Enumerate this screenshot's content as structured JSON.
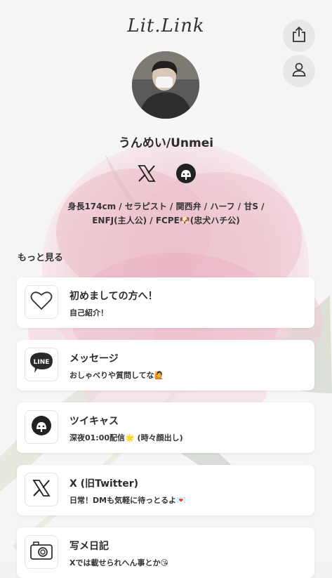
{
  "logo": "Lit.Link",
  "profile": {
    "name": "うんめい/Unmei",
    "bio_line1": "身長174cm / セラピスト / 関西弁 / ハーフ / 甘S /",
    "bio_line2": "ENFJ(主人公) / FCPE🐶(忠犬ハチ公)"
  },
  "social_icons": [
    "x-icon",
    "twitcasting-icon"
  ],
  "more_label": "もっと見る",
  "links": [
    {
      "icon": "heart-icon",
      "title": "初めましての方へ！",
      "sub": "自己紹介！"
    },
    {
      "icon": "line-icon",
      "title": "メッセージ",
      "sub": "おしゃべりや質問してな🙋"
    },
    {
      "icon": "twitcasting-icon",
      "title": "ツイキャス",
      "sub": "深夜01:00配信🌟 (時々顔出し)"
    },
    {
      "icon": "x-icon",
      "title": "X (旧Twitter)",
      "sub": "日常！DMも気軽に待っとるよ💌"
    },
    {
      "icon": "camera-icon",
      "title": "写メ日記",
      "sub": "Xでは載せられへん事とか😘"
    }
  ],
  "colors": {
    "card_bg": "#ffffff",
    "page_bg": "#f4f3f3",
    "flower": "#e6a7b6"
  }
}
